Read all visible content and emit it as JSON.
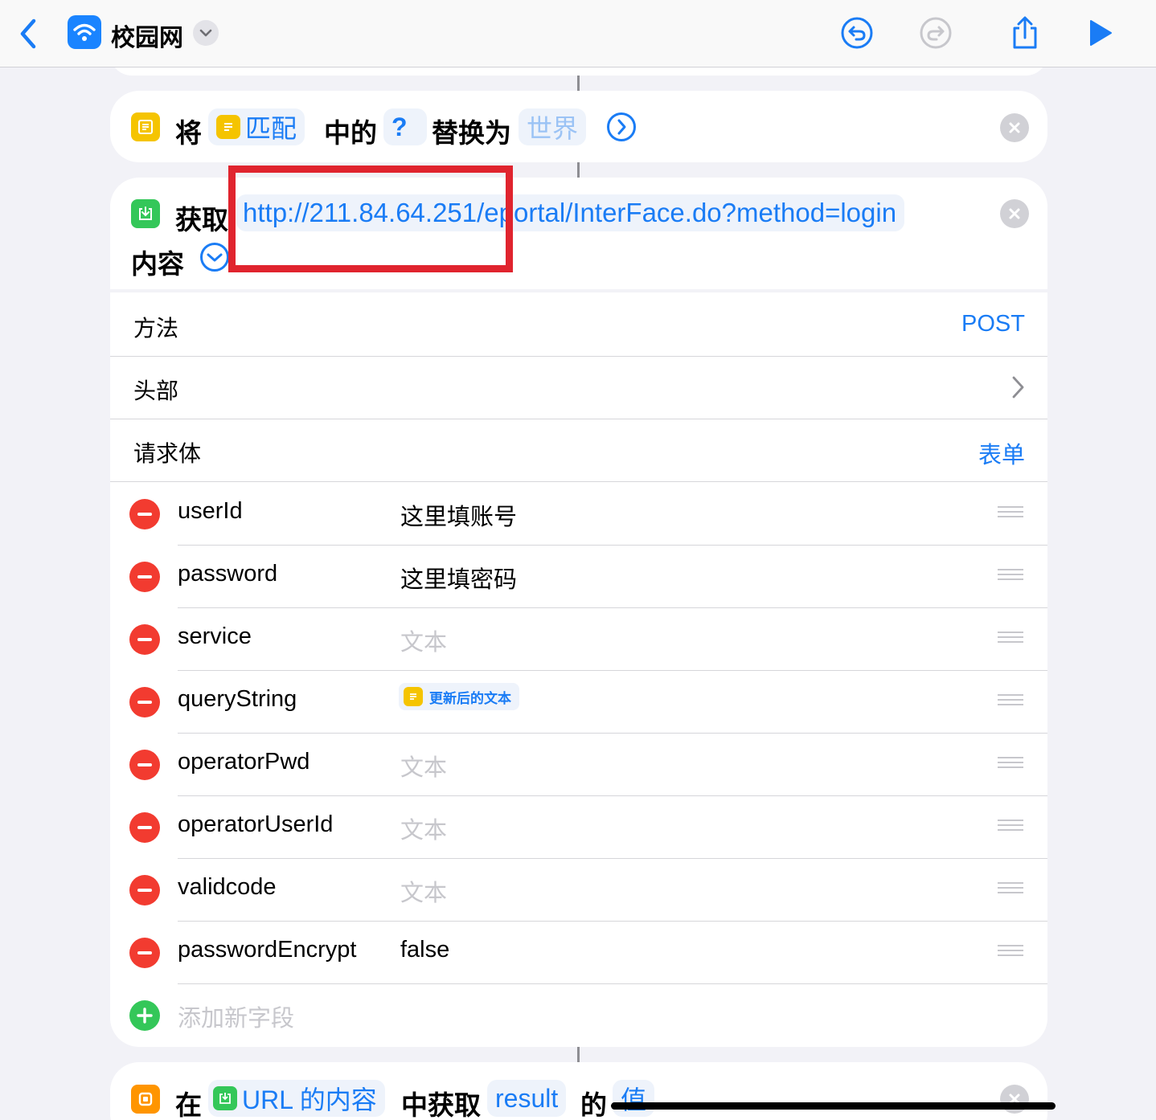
{
  "nav": {
    "title": "校园网",
    "icons": [
      "back-chevron-icon",
      "wifi-icon",
      "chevron-down-icon",
      "undo-icon",
      "redo-icon",
      "share-icon",
      "play-icon"
    ],
    "accent": "#1a7cf5"
  },
  "replace_action": {
    "word_replace": "将",
    "match_token": "匹配",
    "word_in": "中的",
    "pattern_token": "?",
    "word_replace_with": "替换为",
    "replacement_placeholder": "世界"
  },
  "fetch_action": {
    "word_get": "获取",
    "url": "http://211.84.64.251/eportal/InterFace.do?method=login",
    "word_contents": "内容",
    "method": {
      "label": "方法",
      "value": "POST"
    },
    "headers": {
      "label": "头部"
    },
    "body": {
      "label": "请求体",
      "value": "表单"
    },
    "fields": [
      {
        "key": "userId",
        "value": "这里填账号",
        "placeholder": false
      },
      {
        "key": "password",
        "value": "这里填密码",
        "placeholder": false
      },
      {
        "key": "service",
        "value": "文本",
        "placeholder": true
      },
      {
        "key": "queryString",
        "value": "更新后的文本",
        "token": true
      },
      {
        "key": "operatorPwd",
        "value": "文本",
        "placeholder": true
      },
      {
        "key": "operatorUserId",
        "value": "文本",
        "placeholder": true
      },
      {
        "key": "validcode",
        "value": "文本",
        "placeholder": true
      },
      {
        "key": "passwordEncrypt",
        "value": "false",
        "placeholder": false
      }
    ],
    "add_field": "添加新字段"
  },
  "dict_action": {
    "word_in": "在",
    "source_token": "URL 的内容",
    "word_get": "中获取",
    "key_token": "result",
    "word_of": "的",
    "value_token": "值"
  },
  "colors": {
    "delete": "#f23b30",
    "add": "#34c759",
    "text_icon": "#f5c400",
    "web_icon": "#34c759",
    "dict_icon": "#ff9500",
    "highlight": "#e0242e"
  }
}
